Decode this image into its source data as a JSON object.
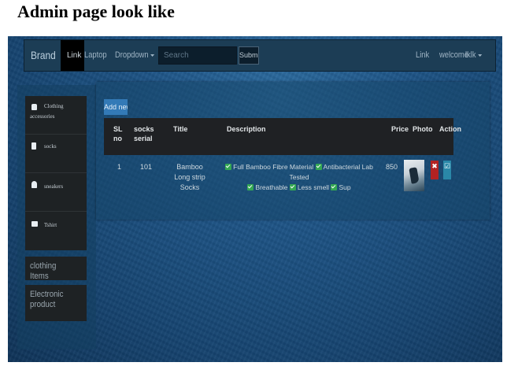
{
  "heading": "Admin page look like",
  "navbar": {
    "brand": "Brand",
    "active_link": "Link",
    "laptop": "Laptop",
    "dropdown": "Dropdown",
    "search_placeholder": "Search",
    "submit": "Submit",
    "right_link": "Link",
    "welcome": "welcome",
    "user": "lklk"
  },
  "sidebar": {
    "category_line1": "Clothing",
    "category_line2": "accessories",
    "items": [
      "socks",
      "sneakers",
      "Tshirt"
    ],
    "boxes": [
      "clothing Items",
      "Electronic product"
    ]
  },
  "add_button": "Add new",
  "table": {
    "headers": {
      "sl": "SL no",
      "serial": "socks serial",
      "title": "Title",
      "description": "Description",
      "price": "Price",
      "photo": "Photo",
      "action": "Action"
    },
    "row": {
      "sl": "1",
      "serial": "101",
      "title": "Bamboo Long strip Socks",
      "features": [
        "Full Bamboo Fibre Material",
        "Antibacterial Lab Tested",
        "Breathable",
        "Less smell",
        "Sup"
      ],
      "price": "850"
    }
  },
  "colors": {
    "accent": "#337ab7",
    "delete": "#b22222",
    "edit": "#2a88a8",
    "check": "#34a853"
  },
  "icons": [
    "bag-icon",
    "book-icon",
    "user-icon",
    "bus-icon",
    "check-icon",
    "close-icon",
    "edit-icon",
    "caret-down-icon"
  ]
}
